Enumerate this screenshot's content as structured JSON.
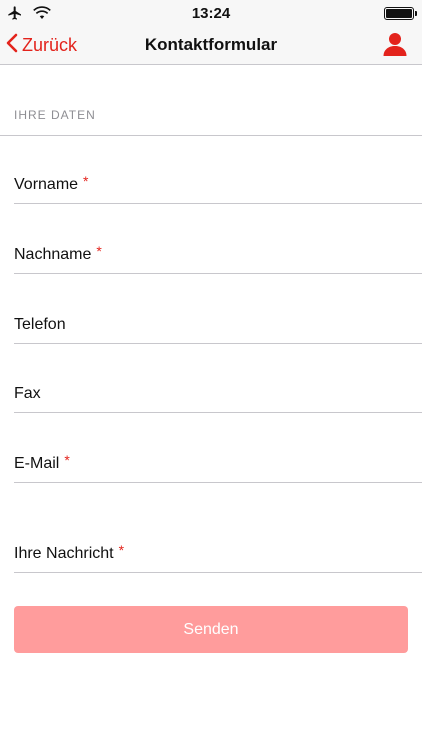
{
  "status_bar": {
    "time": "13:24"
  },
  "nav": {
    "back_label": "Zurück",
    "title": "Kontaktformular"
  },
  "form": {
    "section_header": "IHRE DATEN",
    "fields": [
      {
        "label": "Vorname",
        "required": "*"
      },
      {
        "label": "Nachname",
        "required": "*"
      },
      {
        "label": "Telefon"
      },
      {
        "label": "Fax"
      },
      {
        "label": "E-Mail",
        "required": "*"
      },
      {
        "label": "Ihre Nachricht",
        "required": "*"
      }
    ],
    "submit_label": "Senden"
  },
  "colors": {
    "accent": "#e3231c",
    "submit_disabled": "#ff9c9c",
    "bar_background": "#f7f7f7",
    "separator": "#c8c7cc"
  }
}
